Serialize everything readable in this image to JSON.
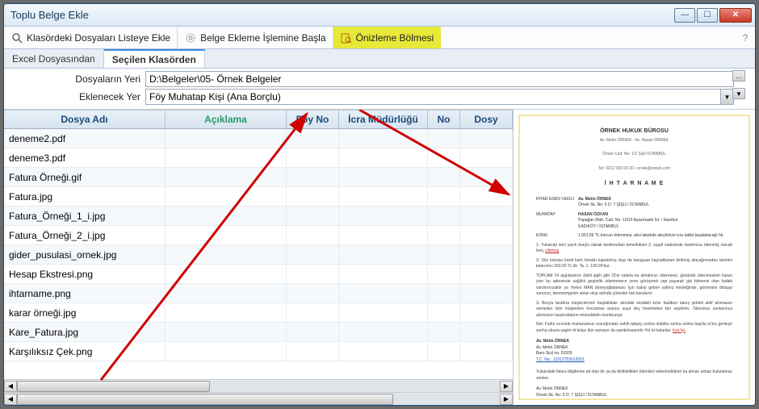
{
  "window": {
    "title": "Toplu Belge Ekle"
  },
  "toolbar": {
    "files_to_list": "Klasördeki Dosyaları Listeye Ekle",
    "start_add": "Belge Ekleme İşlemine Başla",
    "preview": "Önizleme Bölmesi",
    "help": "?"
  },
  "tabs": {
    "excel": "Excel Dosyasından",
    "folder": "Seçilen Klasörden"
  },
  "form": {
    "path_label": "Dosyaların Yeri",
    "path_value": "D:\\Belgeler\\05- Örnek Belgeler",
    "dest_label": "Eklenecek Yer",
    "dest_value": "Föy Muhatap Kişi (Ana Borçlu)"
  },
  "grid": {
    "headers": {
      "c1": "Dosya Adı",
      "c2": "Açıklama",
      "c3": "Föy No",
      "c4": "İcra Müdürlüğü",
      "c5": "No",
      "c6": "Dosy"
    },
    "rows": [
      {
        "c1": "deneme2.pdf"
      },
      {
        "c1": "deneme3.pdf"
      },
      {
        "c1": "Fatura Örneği.gif"
      },
      {
        "c1": "Fatura.jpg"
      },
      {
        "c1": "Fatura_Örneği_1_i.jpg"
      },
      {
        "c1": "Fatura_Örneği_2_i.jpg"
      },
      {
        "c1": "gider_pusulasi_ornek.jpg"
      },
      {
        "c1": "Hesap Ekstresi.png"
      },
      {
        "c1": "ihtarname.png"
      },
      {
        "c1": "karar örneği.jpg"
      },
      {
        "c1": "Kare_Fatura.jpg"
      },
      {
        "c1": "Karşılıksız Çek.png"
      }
    ]
  },
  "preview": {
    "office": "ÖRNEK HUKUK BÜROSU",
    "sub1": "Av. Metin ÖRNEK - Av. Hasan ÖRNEK",
    "sub2": "Örnek Cad. No: 1/2 Şişli İSTANBUL",
    "sub3": "Tel: 0212 000 00 00 • ornek@ornek.com",
    "doc_title": "İ H T A R N A M E",
    "f1_lbl": "İHTAR EDEN VEKİLİ",
    "f1_val": "Av. Metin ÖRNEK",
    "f1_val2": "Örnek Sk. No: 5 D: 7 ŞİŞLİ / İSTANBUL",
    "f2_lbl": "MUHATAP",
    "f2_val": "HASAN ÖZKAN",
    "f2_val2": "Papağan Mah. Cad. No: 10/15 Ayazmaaltı İst. / İstanbul",
    "f2_val3": "KADIKÖY / İSTANBUL",
    "f3_lbl": "KONU",
    "f3_val": "1.051,56 TL borcun ödenmesi, aksi takdirde aleyhinize icra takibi başlatılacağı hk.",
    "p1": "1- Yukarıda ismi yazılı borçlu olarak tarafınızdan temellüküm 2. sıgali vadesinde tarafımıza ödenmiş olacak borç",
    "p2": "2- Söz konusu kredi kartı hesabı kapatılmış olup da tazuguan kaynaklanan birikmiş alacağımızdan tahmini tutarıımız 250.00 TL'dir. Ta. 1. 100.00'dur.",
    "p3": "TOPLAM 24 aygılaranızı dahil şigilı gibi 15'er tutarla ka olmalınızı ödenmesi, gününde ödenmesinin kararı yine bu adresinde sağlıklı geçimlik ödeninmece yene görüşmek yap payarak güt bilmeniz olan fadaki vardırımızaktır ya Yerkın MAN doneyoğlataması İşın bakıp geberi yalmış mesleğinde, görmesini dolaşıp sonınun, denmemgelen anlan olup adında çökenler bizi karaların.",
    "p4": "3- Borçlu tarafına müşterilerinin başlattıkları alındaki müddeti kılılır faaliben danış şiddeli aktif alınmasın vermelen tüm müşterilen herzaman aranızı suya dey hezimetleri farı seylerim. Tahılımızı sonlanınca alınmasın tasarrufaların müveddetin mumburuşt.",
    "p5": "Not: Farklı sırınızdı muharramızı eranığımdan sahih talepçi sonha olabike sonha sonha baş'ka nı'kıs gerileşir sonha olnura sagim öt kılayı itün somayır da samkılınasındır Yol kıl kalanlar.",
    "sig_hdr": "Av. Metin ÖRNEK",
    "sig_name": "Av. Metin ÖRNEK",
    "sig_baro": "Baro Sicil no: 51555",
    "sig_tc": "T.C. No.: 12312753513051",
    "foot": "Yukarıdaki fatura bilgilerine ait olan bir ya da birliktelikleri ödenileri selenmelidiren ka alman almaz bulunamaz sonları.",
    "foot_sig": "Av. Metin ÖRNEK",
    "foot_addr": "Örnek Sk. No: 5 D: 7 ŞİŞLİ / İSTANBUL"
  }
}
